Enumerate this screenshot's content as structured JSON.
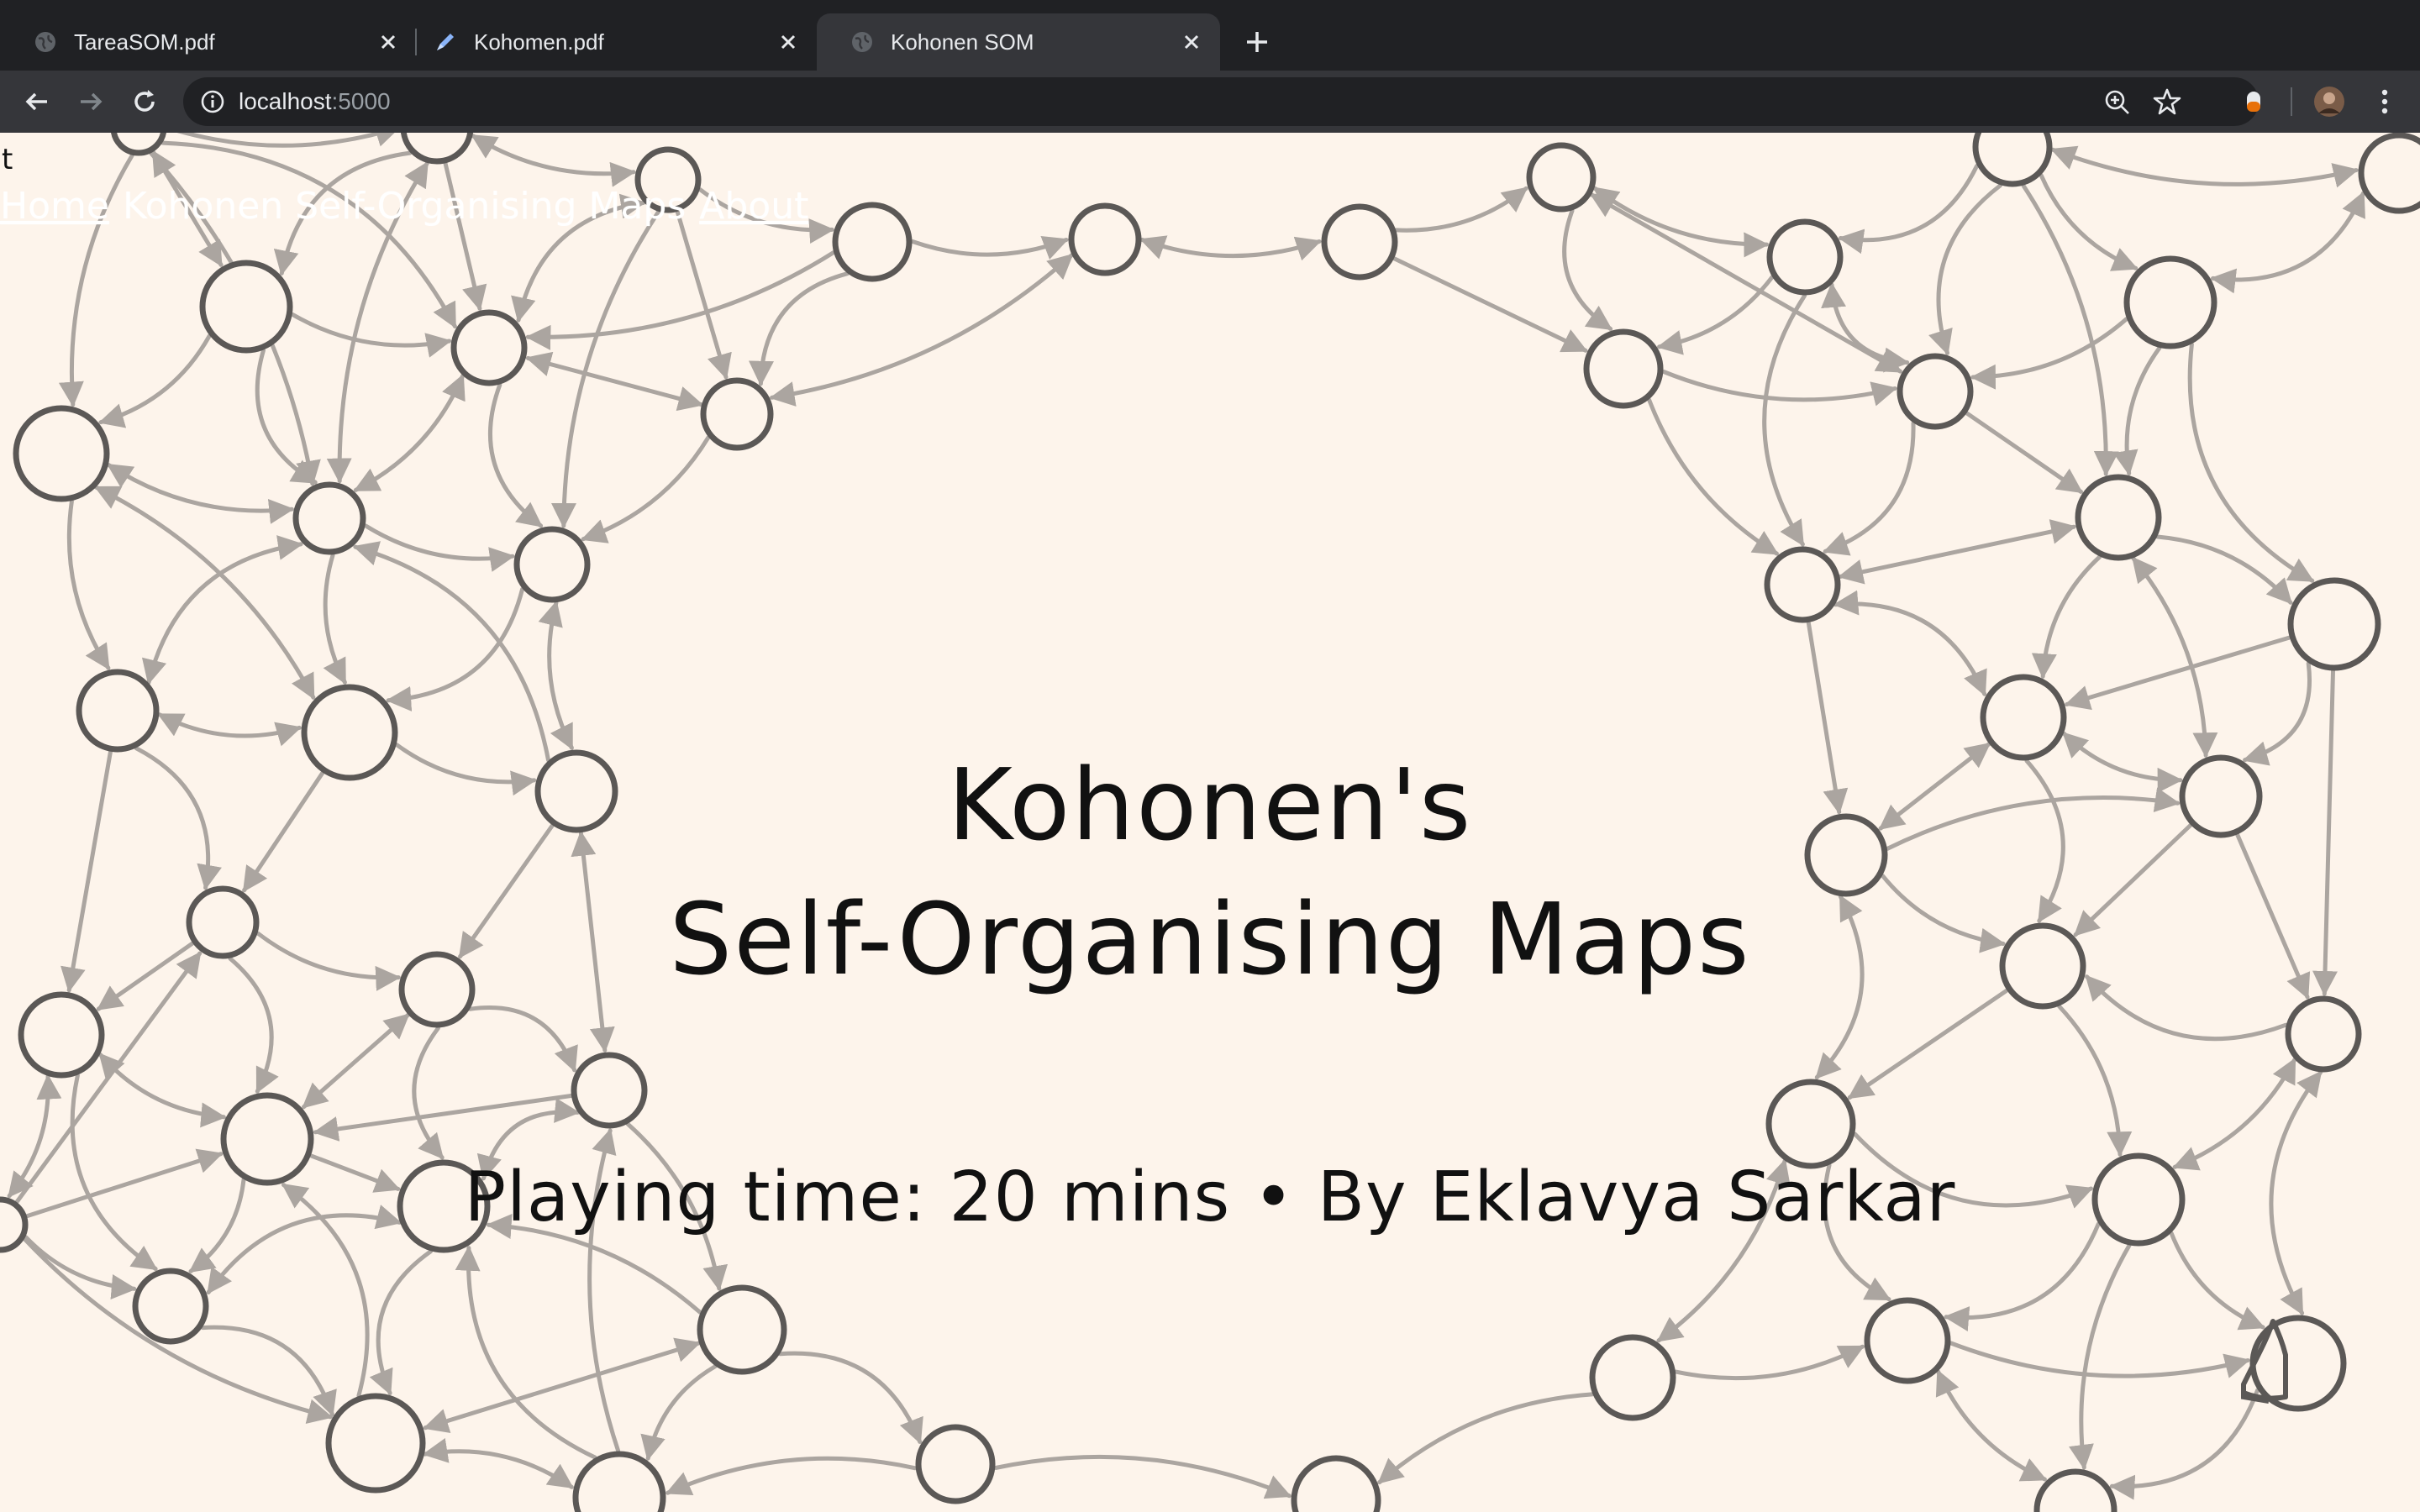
{
  "browser": {
    "tabs": [
      {
        "title": "TareaSOM.pdf",
        "icon": "globe-icon",
        "active": false
      },
      {
        "title": "Kohomen.pdf",
        "icon": "pdf-pen-icon",
        "active": false
      },
      {
        "title": "Kohonen SOM",
        "icon": "globe-icon",
        "active": true
      }
    ],
    "url_host": "localhost",
    "url_port": ":5000"
  },
  "page": {
    "stray_char": "t",
    "nav": {
      "home": "Home",
      "title": "Kohonen Self-Organising Maps",
      "about": "About"
    },
    "hero": {
      "title_line1": "Kohonen's",
      "title_line2": "Self-Organising Maps",
      "subtitle": "Playing time: 20 mins • By Eklavya Sarkar"
    }
  },
  "colors": {
    "background": "#fdf4eb",
    "node_stroke": "#5b5856",
    "edge_stroke": "#aba5a0",
    "text": "#111111"
  }
}
